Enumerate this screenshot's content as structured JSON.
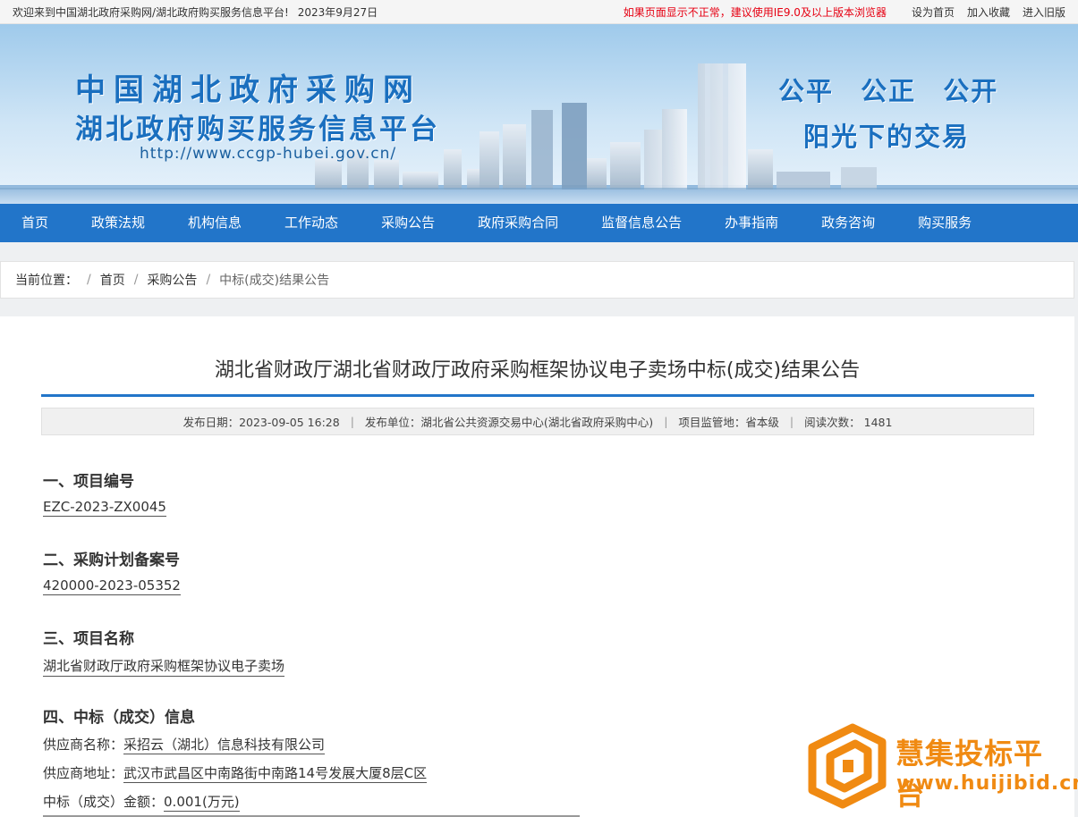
{
  "topbar": {
    "welcome": "欢迎来到中国湖北政府采购网/湖北政府购买服务信息平台!",
    "date": "2023年9月27日",
    "warning": "如果页面显示不正常，建议使用IE9.0及以上版本浏览器",
    "links": [
      "设为首页",
      "加入收藏",
      "进入旧版"
    ]
  },
  "banner": {
    "title1": "中国湖北政府采购网",
    "title2": "湖北政府购买服务信息平台",
    "url": "http://www.ccgp-hubei.gov.cn/",
    "slogan1": "公平 公正 公开",
    "slogan2": "阳光下的交易"
  },
  "nav": [
    "首页",
    "政策法规",
    "机构信息",
    "工作动态",
    "采购公告",
    "政府采购合同",
    "监督信息公告",
    "办事指南",
    "政务咨询",
    "购买服务"
  ],
  "breadcrumb": {
    "label": "当前位置：",
    "items": [
      "首页",
      "采购公告"
    ],
    "current": "中标(成交)结果公告"
  },
  "article": {
    "title": "湖北省财政厅湖北省财政厅政府采购框架协议电子卖场中标(成交)结果公告",
    "meta": {
      "date": "发布日期：2023-09-05 16:28",
      "publisher": "发布单位：湖北省公共资源交易中心(湖北省政府采购中心)",
      "region": "项目监管地：省本级",
      "views": "阅读次数：  1481"
    },
    "sections": [
      {
        "heading": "一、项目编号",
        "value": "EZC-2023-ZX0045"
      },
      {
        "heading": "二、采购计划备案号",
        "value": "420000-2023-05352"
      },
      {
        "heading": "三、项目名称",
        "value": "湖北省财政厅政府采购框架协议电子卖场"
      },
      {
        "heading": "四、中标（成交）信息"
      }
    ],
    "award": [
      {
        "label": "供应商名称：",
        "value": "采招云（湖北）信息科技有限公司"
      },
      {
        "label": "供应商地址：",
        "value": "武汉市武昌区中南路街中南路14号发展大厦8层C区"
      },
      {
        "label": "中标（成交）金额：",
        "value": "0.001(万元)"
      }
    ]
  },
  "watermark": {
    "title": "慧集投标平台",
    "url": "www.huijibid.cn"
  }
}
